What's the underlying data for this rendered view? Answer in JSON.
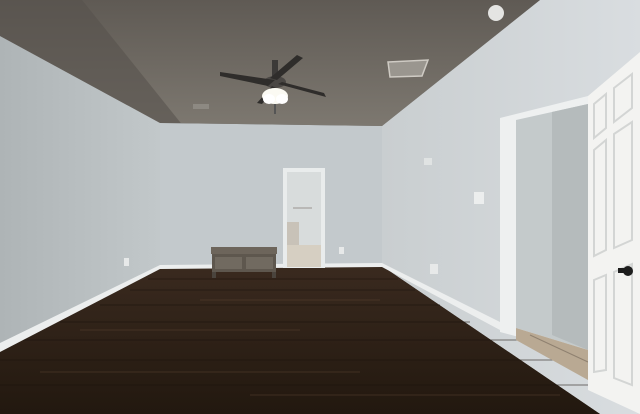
{
  "scene": {
    "description_free": true,
    "colors": {
      "ceiling": "#6f6a63",
      "ceiling_light": "#8a857d",
      "wall_left": "#b9bfc1",
      "wall_back": "#c7cdd0",
      "wall_right": "#d3d8da",
      "floor_dark": "#2b1f17",
      "floor_mid": "#3d2c20",
      "baseboard": "#eef0f0",
      "door": "#f2f2f0",
      "bench": "#6b6258"
    }
  }
}
